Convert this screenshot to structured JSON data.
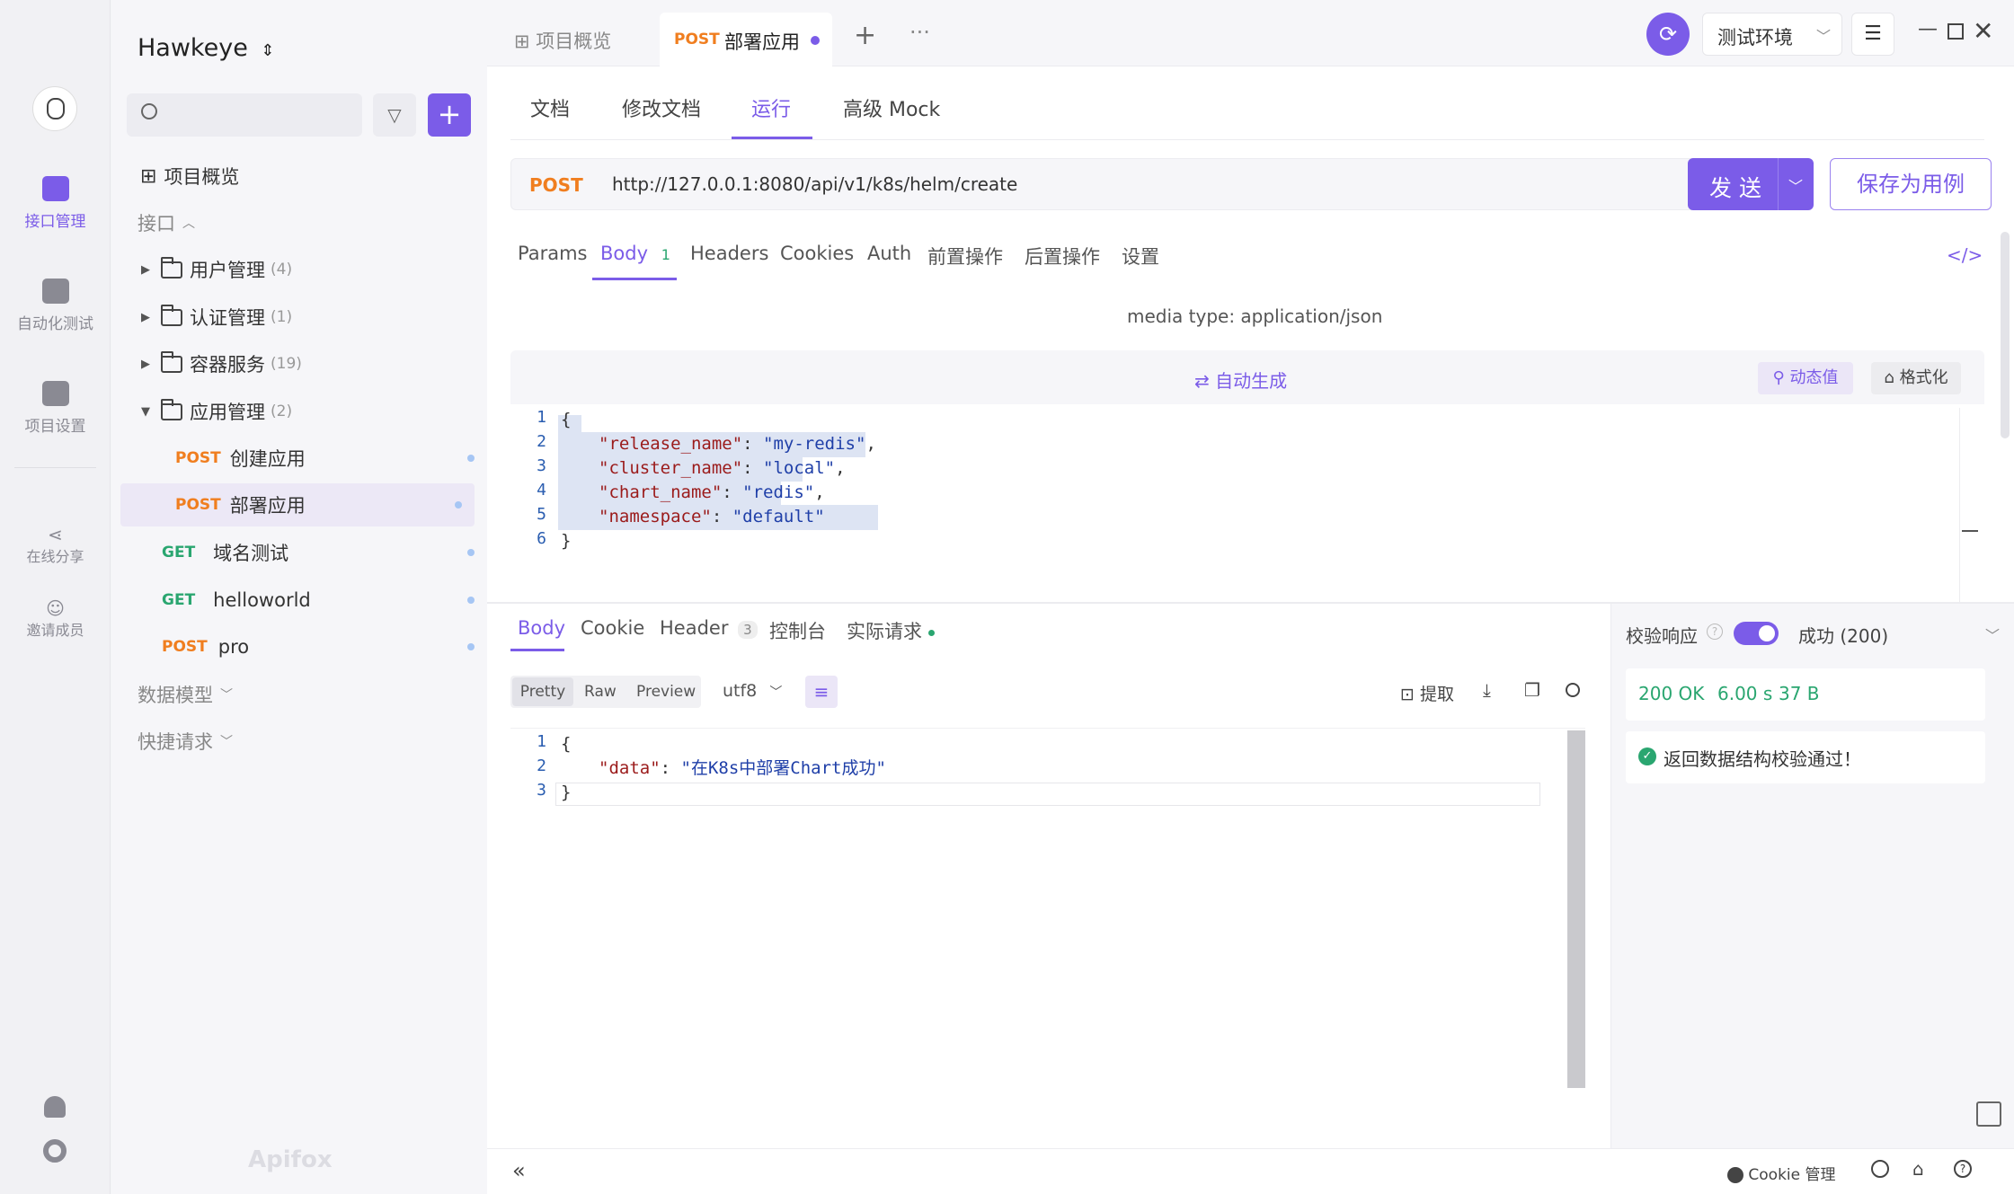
{
  "app": {
    "project_name": "Hawkeye",
    "watermark": "Apifox"
  },
  "rail": {
    "items": [
      {
        "label": "接口管理",
        "icon": "api-management-icon"
      },
      {
        "label": "自动化测试",
        "icon": "automation-test-icon"
      },
      {
        "label": "项目设置",
        "icon": "project-settings-icon"
      }
    ],
    "share": "在线分享",
    "invite": "邀请成员"
  },
  "sidebar": {
    "search_placeholder": "",
    "overview": "项目概览",
    "section_api": "接口",
    "folders": [
      {
        "name": "用户管理",
        "count": "(4)"
      },
      {
        "name": "认证管理",
        "count": "(1)"
      },
      {
        "name": "容器服务",
        "count": "(19)"
      },
      {
        "name": "应用管理",
        "count": "(2)"
      }
    ],
    "endpoints": [
      {
        "method": "POST",
        "name": "创建应用"
      },
      {
        "method": "POST",
        "name": "部署应用"
      },
      {
        "method": "GET",
        "name": "域名测试"
      },
      {
        "method": "GET",
        "name": "helloworld"
      },
      {
        "method": "POST",
        "name": "pro"
      }
    ],
    "section_models": "数据模型",
    "section_quick": "快捷请求"
  },
  "tabs": {
    "overview": "项目概览",
    "active_method": "POST",
    "active_name": "部署应用",
    "environment": "测试环境"
  },
  "subtabs": [
    "文档",
    "修改文档",
    "运行",
    "高级 Mock"
  ],
  "request": {
    "method": "POST",
    "url": "http://127.0.0.1:8080/api/v1/k8s/helm/create",
    "send": "发 送",
    "save_as_case": "保存为用例",
    "tabs": [
      "Params",
      "Body",
      "Headers",
      "Cookies",
      "Auth",
      "前置操作",
      "后置操作",
      "设置"
    ],
    "body_badge": "1",
    "media_type": "media type: application/json",
    "auto_generate": "自动生成",
    "dynamic_value": "动态值",
    "format": "格式化",
    "body_lines": [
      {
        "n": "1",
        "text": "{"
      },
      {
        "n": "2",
        "key": "\"release_name\"",
        "val": "\"my-redis\"",
        "end": ","
      },
      {
        "n": "3",
        "key": "\"cluster_name\"",
        "val": "\"local\"",
        "end": ","
      },
      {
        "n": "4",
        "key": "\"chart_name\"",
        "val": "\"redis\"",
        "end": ","
      },
      {
        "n": "5",
        "key": "\"namespace\"",
        "val": "\"default\"",
        "end": ""
      },
      {
        "n": "6",
        "text": "}"
      }
    ]
  },
  "response": {
    "tabs": [
      "Body",
      "Cookie",
      "Header",
      "控制台",
      "实际请求"
    ],
    "header_badge": "3",
    "views": [
      "Pretty",
      "Raw",
      "Preview"
    ],
    "encoding": "utf8",
    "extract": "提取",
    "lines": [
      {
        "n": "1",
        "text": "{"
      },
      {
        "n": "2",
        "key": "\"data\"",
        "val": "\"在K8s中部署Chart成功\""
      },
      {
        "n": "3",
        "text": "}"
      }
    ],
    "validate_label": "校验响应",
    "validate_on": true,
    "success_label": "成功 (200)",
    "status": "200 OK",
    "time": "6.00 s",
    "size": "37 B",
    "validate_msg": "返回数据结构校验通过！"
  },
  "footer": {
    "cookie_mgmt": "Cookie 管理"
  },
  "colors": {
    "accent": "#7b5ce8",
    "post": "#f07e1f",
    "get": "#2aa670",
    "ok": "#2aa670"
  }
}
